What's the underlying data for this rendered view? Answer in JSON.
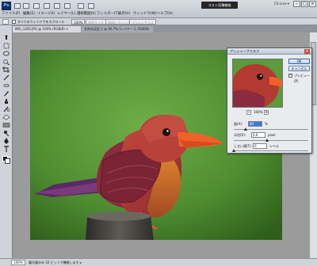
{
  "app": {
    "logo": "Ps",
    "workspace_button": "コスト見積機能",
    "cs_live": "CS Live ▾",
    "window_controls": {
      "minimize": "–",
      "maximize": "□",
      "close": "×"
    }
  },
  "menu": {
    "items": [
      "ファイル(F)",
      "編集(E)",
      "イメージ(I)",
      "レイヤー(L)",
      "選択範囲(S)",
      "フィルター(T)",
      "表示(V)",
      "ウィンドウ(W)",
      "ヘルプ(H)"
    ]
  },
  "options_bar": {
    "checkbox_label": "すべてのウィンドウをスクロール",
    "buttons": [
      "100%",
      "画面サイズ",
      "画面にフィット",
      "プリントサイズ"
    ]
  },
  "tabs": [
    {
      "label": "IMG_1265.JPG @ 100% (RGB/8) ×"
    },
    {
      "label": "名称未設定 1 @ 66.7% (レイヤー 1, RGB/8) ×"
    }
  ],
  "dialog": {
    "title": "アンシャープマスク",
    "close": "×",
    "ok": "OK",
    "cancel": "キャンセル",
    "preview_label": "プレビュー(P)",
    "preview_checked": true,
    "zoom_out": "−",
    "zoom_in": "+",
    "zoom_value": "100%",
    "amount": {
      "label": "量(A):",
      "value": "80",
      "unit": "%",
      "slider_level": 0.16
    },
    "radius": {
      "label": "半径(R):",
      "value": "0.6",
      "unit": "pixel",
      "slider_level": 0.45
    },
    "threshold": {
      "label": "しきい値(T):",
      "value": "0",
      "unit": "レベル",
      "slider_level": 0.0
    }
  },
  "status": {
    "zoom": "100%",
    "doc_info": "露光量のみ 32 ビットで機能します ▸"
  },
  "colors": {
    "background_green": "#5c9a3c",
    "bird_body": "#b23a30",
    "beak": "#f2602a",
    "accent_blue": "#3d79d9"
  }
}
